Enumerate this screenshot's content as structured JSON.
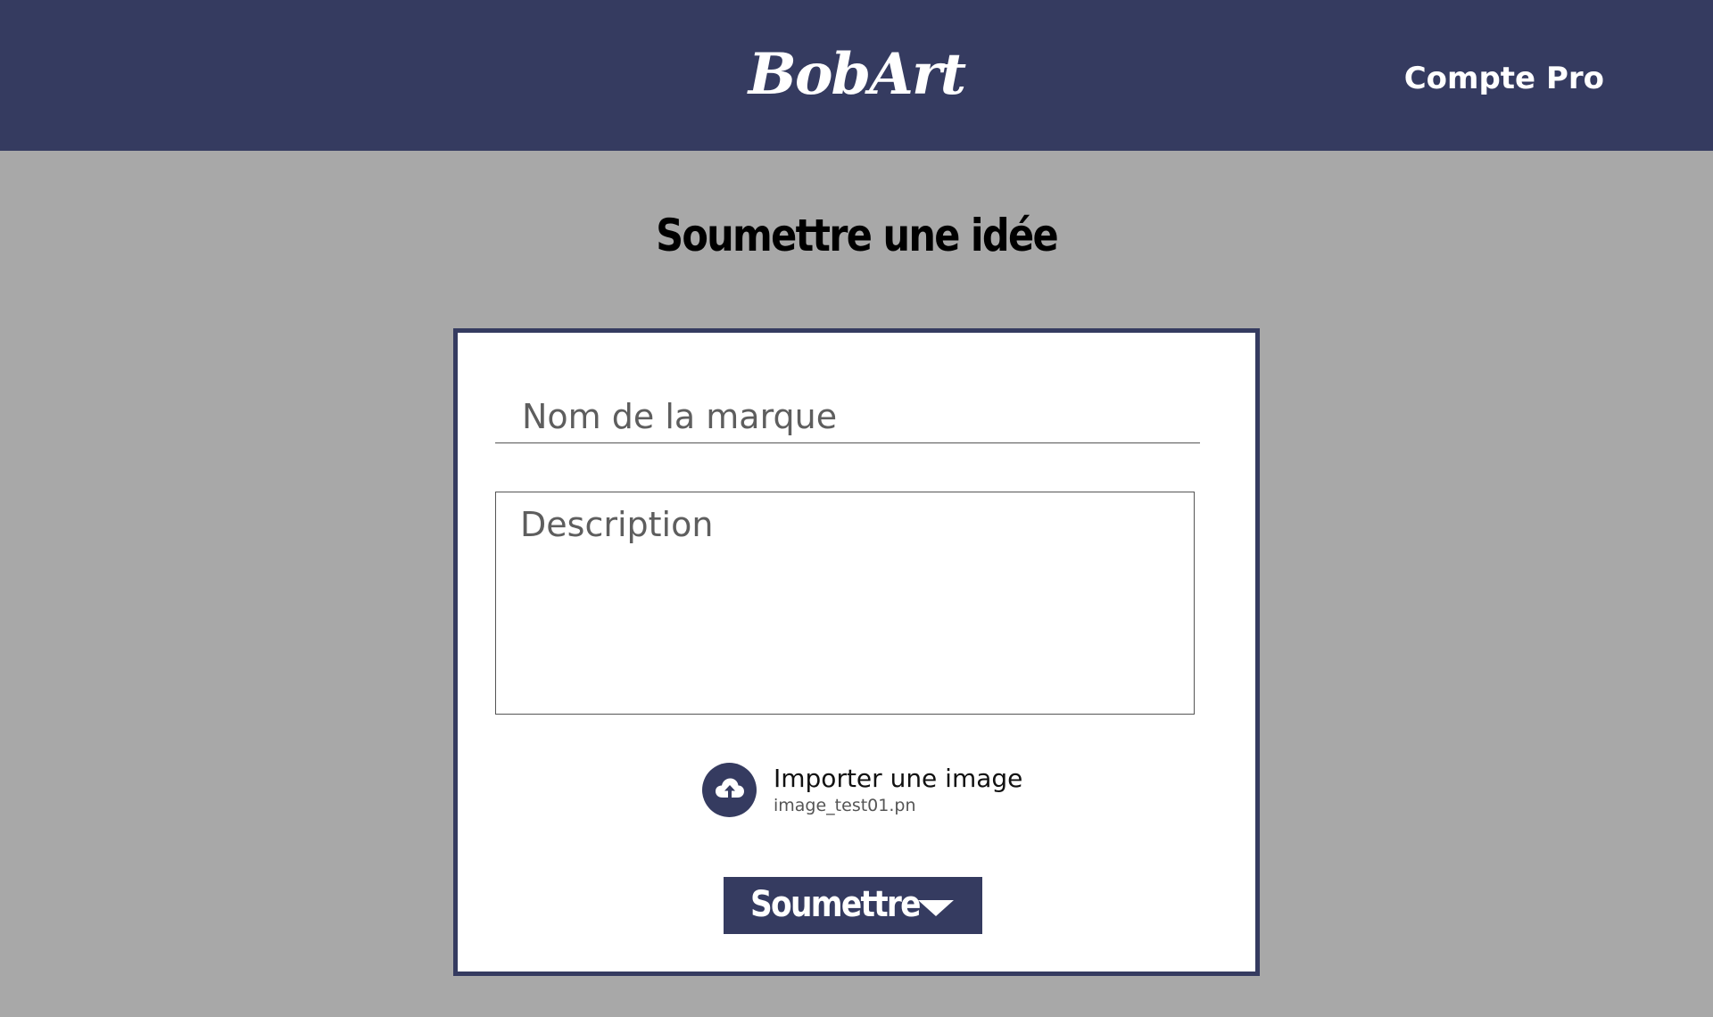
{
  "header": {
    "logo_text": "BobArt",
    "account_link": "Compte Pro",
    "background_color": "#353b60"
  },
  "page": {
    "title": "Soumettre une idée",
    "background_color": "#a8a8a8"
  },
  "form": {
    "brand_name": {
      "placeholder": "Nom de la marque",
      "value": ""
    },
    "description": {
      "placeholder": "Description",
      "value": ""
    },
    "upload": {
      "icon": "cloud-upload-icon",
      "label": "Importer une image",
      "filename": "image_test01.pn"
    },
    "submit": {
      "label": "Soumettre",
      "icon": "chevron-down-icon"
    }
  }
}
